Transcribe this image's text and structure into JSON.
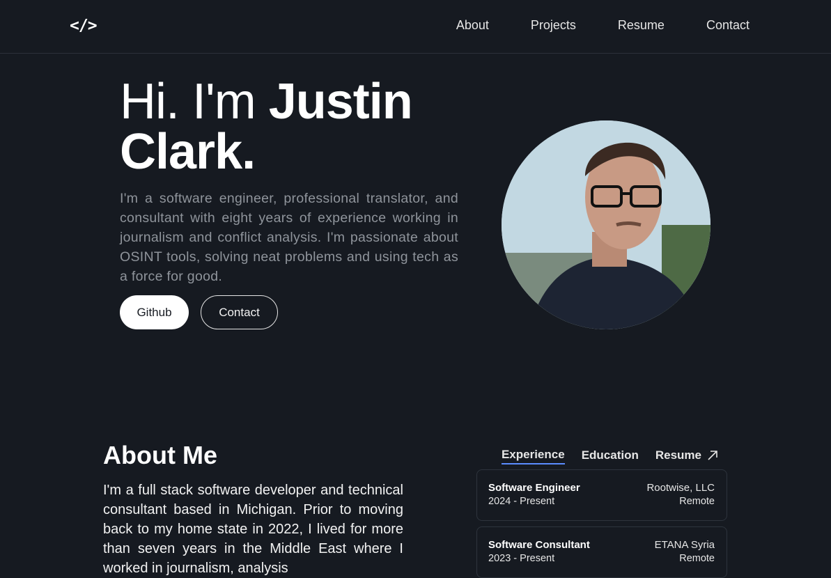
{
  "nav": {
    "logo": "</>",
    "links": [
      "About",
      "Projects",
      "Resume",
      "Contact"
    ]
  },
  "hero": {
    "greeting": "Hi. I'm ",
    "name": "Justin Clark.",
    "bio": "I'm a software engineer, professional translator, and consultant with eight years of experience working in journalism and conflict analysis. I'm passionate about OSINT tools, solving neat problems and using tech as a force for good.",
    "buttons": {
      "github": "Github",
      "contact": "Contact"
    }
  },
  "about": {
    "title": "About Me",
    "text": "I'm a full stack software developer and technical consultant based in Michigan. Prior to moving back to my home state in 2022, I lived for more than seven years in the Middle East where I worked in journalism, analysis"
  },
  "tabs": {
    "experience": "Experience",
    "education": "Education",
    "resume": "Resume"
  },
  "experience": [
    {
      "role": "Software Engineer",
      "dates": "2024 - Present",
      "company": "Rootwise, LLC",
      "location": "Remote"
    },
    {
      "role": "Software Consultant",
      "dates": "2023 - Present",
      "company": "ETANA Syria",
      "location": "Remote"
    }
  ],
  "colors": {
    "background": "#161a21",
    "accent": "#5b8cff"
  }
}
